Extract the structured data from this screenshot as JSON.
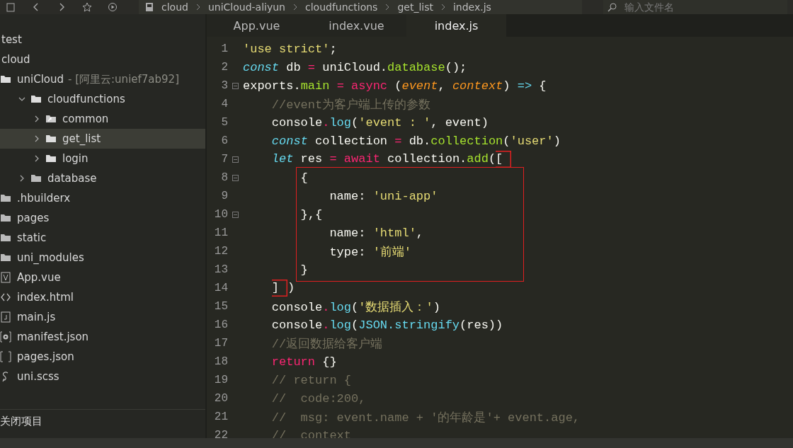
{
  "toolbar": {
    "breadcrumbs": [
      "cloud",
      "uniCloud-aliyun",
      "cloudfunctions",
      "get_list",
      "index.js"
    ],
    "search": {
      "placeholder": "输入文件名"
    }
  },
  "sidebar": {
    "items": [
      {
        "label": "test",
        "kind": "project"
      },
      {
        "label": "cloud",
        "kind": "project"
      },
      {
        "label": "uniCloud",
        "detail": "- [阿里云:unief7ab92]",
        "kind": "folder",
        "selected": false,
        "children": [
          {
            "label": "cloudfunctions",
            "kind": "folder",
            "expanded": true,
            "selected": false,
            "children": [
              {
                "label": "common",
                "kind": "linked-folder",
                "expanded": false,
                "selected": false
              },
              {
                "label": "get_list",
                "kind": "folder",
                "expanded": false,
                "selected": true
              },
              {
                "label": "login",
                "kind": "folder",
                "expanded": false,
                "selected": false
              }
            ]
          },
          {
            "label": "database",
            "kind": "plain-folder",
            "expanded": false,
            "selected": false
          }
        ]
      },
      {
        "label": ".hbuilderx",
        "kind": "plain-folder",
        "selected": false
      },
      {
        "label": "pages",
        "kind": "plain-folder",
        "selected": false
      },
      {
        "label": "static",
        "kind": "plain-folder",
        "selected": false
      },
      {
        "label": "uni_modules",
        "kind": "plain-folder",
        "selected": false
      },
      {
        "label": "App.vue",
        "kind": "vue",
        "selected": false
      },
      {
        "label": "index.html",
        "kind": "html",
        "selected": false
      },
      {
        "label": "main.js",
        "kind": "js",
        "selected": false
      },
      {
        "label": "manifest.json",
        "kind": "manifest",
        "selected": false
      },
      {
        "label": "pages.json",
        "kind": "json",
        "selected": false
      },
      {
        "label": "uni.scss",
        "kind": "scss",
        "selected": false
      }
    ],
    "footer": "关闭项目"
  },
  "tabs": [
    {
      "label": "App.vue",
      "selected": false
    },
    {
      "label": "index.vue",
      "selected": false
    },
    {
      "label": "index.js",
      "selected": true
    }
  ],
  "editor": {
    "lines": [
      {
        "kind": "line",
        "number": "1",
        "fold": false,
        "tokens": [
          {
            "kind": "str",
            "text": "'use strict'"
          },
          {
            "kind": "plain",
            "text": ";"
          }
        ]
      },
      {
        "kind": "line",
        "number": "2",
        "fold": false,
        "tokens": [
          {
            "kind": "kw",
            "text": "const"
          },
          {
            "kind": "plain",
            "text": " db "
          },
          {
            "kind": "op",
            "text": "="
          },
          {
            "kind": "plain",
            "text": " uniCloud."
          },
          {
            "kind": "fn",
            "text": "database"
          },
          {
            "kind": "plain",
            "text": "();"
          }
        ]
      },
      {
        "kind": "line",
        "number": "3",
        "fold": true,
        "tokens": [
          {
            "kind": "plain",
            "text": "exports."
          },
          {
            "kind": "fn",
            "text": "main"
          },
          {
            "kind": "op",
            "text": " = async"
          },
          {
            "kind": "plain",
            "text": " ("
          },
          {
            "kind": "param",
            "text": "event"
          },
          {
            "kind": "plain",
            "text": ", "
          },
          {
            "kind": "param",
            "text": "context"
          },
          {
            "kind": "plain",
            "text": ") "
          },
          {
            "kind": "builtin",
            "text": "=>"
          },
          {
            "kind": "plain",
            "text": " {"
          }
        ]
      },
      {
        "kind": "line",
        "number": "4",
        "fold": false,
        "tokens": [
          {
            "kind": "comment",
            "text": "    //event为客户端上传的参数"
          }
        ]
      },
      {
        "kind": "line",
        "number": "5",
        "fold": false,
        "tokens": [
          {
            "kind": "plain",
            "text": "    console"
          },
          {
            "kind": "op",
            "text": "."
          },
          {
            "kind": "builtin",
            "text": "log"
          },
          {
            "kind": "plain",
            "text": "("
          },
          {
            "kind": "str",
            "text": "'event : '"
          },
          {
            "kind": "plain",
            "text": ", event)"
          }
        ]
      },
      {
        "kind": "line",
        "number": "6",
        "fold": false,
        "tokens": [
          {
            "kind": "kw",
            "text": "    const"
          },
          {
            "kind": "plain",
            "text": " collection "
          },
          {
            "kind": "op",
            "text": "="
          },
          {
            "kind": "plain",
            "text": " db."
          },
          {
            "kind": "fn",
            "text": "collection"
          },
          {
            "kind": "plain",
            "text": "("
          },
          {
            "kind": "str",
            "text": "'user'"
          },
          {
            "kind": "plain",
            "text": ")"
          }
        ]
      },
      {
        "kind": "line",
        "number": "7",
        "fold": true,
        "tokens": [
          {
            "kind": "kw",
            "text": "    let"
          },
          {
            "kind": "plain",
            "text": " res "
          },
          {
            "kind": "op",
            "text": "= await"
          },
          {
            "kind": "plain",
            "text": " collection."
          },
          {
            "kind": "fn",
            "text": "add"
          },
          {
            "kind": "plain",
            "text": "("
          },
          {
            "kind": "plain",
            "text": "[",
            "boxed": true
          }
        ]
      },
      {
        "kind": "highlight",
        "lines": [
          {
            "number": "8",
            "fold": true,
            "tokens": [
              {
                "kind": "plain",
                "text": "        {"
              }
            ]
          },
          {
            "number": "9",
            "fold": false,
            "tokens": [
              {
                "kind": "plain",
                "text": "            name: "
              },
              {
                "kind": "str",
                "text": "'uni-app'"
              }
            ]
          },
          {
            "number": "10",
            "fold": true,
            "tokens": [
              {
                "kind": "plain",
                "text": "        },{"
              }
            ]
          },
          {
            "number": "11",
            "fold": false,
            "tokens": [
              {
                "kind": "plain",
                "text": "            name: "
              },
              {
                "kind": "str",
                "text": "'html'"
              },
              {
                "kind": "plain",
                "text": ","
              }
            ]
          },
          {
            "number": "12",
            "fold": false,
            "tokens": [
              {
                "kind": "plain",
                "text": "            type: "
              },
              {
                "kind": "str",
                "text": "'前端'"
              }
            ]
          },
          {
            "number": "13",
            "fold": false,
            "tokens": [
              {
                "kind": "plain",
                "text": "        }"
              }
            ]
          }
        ]
      },
      {
        "kind": "line",
        "number": "14",
        "fold": false,
        "tokens": [
          {
            "kind": "plain",
            "text": "    ]",
            "boxed": true
          },
          {
            "kind": "plain",
            "text": ")"
          }
        ]
      },
      {
        "kind": "line",
        "number": "15",
        "fold": false,
        "tokens": [
          {
            "kind": "plain",
            "text": "    console"
          },
          {
            "kind": "op",
            "text": "."
          },
          {
            "kind": "builtin",
            "text": "log"
          },
          {
            "kind": "plain",
            "text": "("
          },
          {
            "kind": "str",
            "text": "'数据插入：'"
          },
          {
            "kind": "plain",
            "text": ")"
          }
        ]
      },
      {
        "kind": "line",
        "number": "16",
        "fold": false,
        "tokens": [
          {
            "kind": "plain",
            "text": "    console"
          },
          {
            "kind": "op",
            "text": "."
          },
          {
            "kind": "builtin",
            "text": "log"
          },
          {
            "kind": "plain",
            "text": "("
          },
          {
            "kind": "builtin",
            "text": "JSON.stringify"
          },
          {
            "kind": "plain",
            "text": "(res))"
          }
        ]
      },
      {
        "kind": "line",
        "number": "17",
        "fold": false,
        "tokens": [
          {
            "kind": "comment",
            "text": "    //返回数据给客户端"
          }
        ]
      },
      {
        "kind": "line",
        "number": "18",
        "fold": false,
        "tokens": [
          {
            "kind": "op",
            "text": "    return"
          },
          {
            "kind": "plain",
            "text": " {}"
          }
        ]
      },
      {
        "kind": "line",
        "number": "19",
        "fold": false,
        "tokens": [
          {
            "kind": "comment",
            "text": "    // return {"
          }
        ]
      },
      {
        "kind": "line",
        "number": "20",
        "fold": false,
        "tokens": [
          {
            "kind": "comment",
            "text": "    //  code:200,"
          }
        ]
      },
      {
        "kind": "line",
        "number": "21",
        "fold": false,
        "tokens": [
          {
            "kind": "comment",
            "text": "    //  msg: event.name + '的年龄是'+ event.age,"
          }
        ]
      },
      {
        "kind": "line",
        "number": "22",
        "fold": false,
        "tokens": [
          {
            "kind": "comment",
            "text": "    //  context"
          }
        ]
      }
    ]
  }
}
